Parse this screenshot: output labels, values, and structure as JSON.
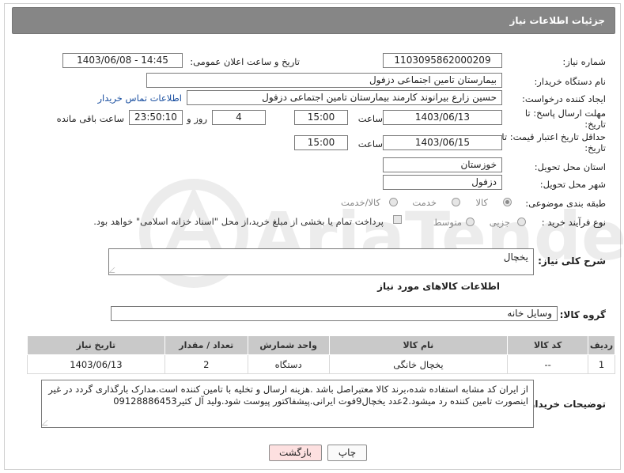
{
  "header": {
    "title": "جزئیات اطلاعات نیاز"
  },
  "form": {
    "need_number_label": "شماره نیاز:",
    "need_number": "1103095862000209",
    "announce_label": "تاریخ و ساعت اعلان عمومی:",
    "announce_value": "1403/06/08 - 14:45",
    "buyer_org_label": "نام دستگاه خریدار:",
    "buyer_org": "بیمارستان تامین اجتماعی دزفول",
    "creator_label": "ایجاد کننده درخواست:",
    "creator": "حسین زارع بیرانوند کارمند بیمارستان تامین اجتماعی دزفول",
    "contact_link": "اطلاعات تماس خریدار",
    "deadline_label_1": "مهلت ارسال پاسخ: تا",
    "deadline_label_2": "تاریخ:",
    "deadline_date": "1403/06/13",
    "time_label": "ساعت",
    "deadline_time": "15:00",
    "days_value": "4",
    "days_label": "روز و",
    "remaining_time": "23:50:10",
    "remaining_label": "ساعت باقی مانده",
    "validity_label_1": "حداقل تاریخ اعتبار قیمت: تا",
    "validity_label_2": "تاریخ:",
    "validity_date": "1403/06/15",
    "validity_time": "15:00",
    "province_label": "استان محل تحویل:",
    "province": "خوزستان",
    "city_label": "شهر محل تحویل:",
    "city": "دزفول",
    "category_label": "طبقه بندی موضوعی:",
    "category_options": [
      "کالا",
      "خدمت",
      "کالا/خدمت"
    ],
    "category_selected": "کالا",
    "process_label": "نوع فرآیند خرید :",
    "process_options": [
      "جزیی",
      "متوسط"
    ],
    "payment_note": "پرداخت تمام یا بخشی از مبلغ خرید،از محل \"اسناد خزانه اسلامی\" خواهد بود."
  },
  "description": {
    "label": "شرح کلی نیاز:",
    "value": "یخچال"
  },
  "goods_section_title": "اطلاعات کالاهای مورد نیاز",
  "goods_group": {
    "label": "گروه کالا:",
    "value": "وسایل خانه"
  },
  "table": {
    "headers": [
      "ردیف",
      "کد کالا",
      "نام کالا",
      "واحد شمارش",
      "تعداد / مقدار",
      "تاریخ نیاز"
    ],
    "rows": [
      [
        "1",
        "--",
        "یخچال خانگی",
        "دستگاه",
        "2",
        "1403/06/13"
      ]
    ]
  },
  "buyer_notes": {
    "label": "توضیحات خریدار:",
    "value": "از ایران کد مشابه استفاده شده،برند کالا معتبراصل باشد .هزینه ارسال و تخلیه با تامین کننده است.مدارک بارگذاری گردد در غیر اینصورت تامین کننده رد میشود.2عدد یخچال9فوت ایرانی.پیشفاکتور پیوست شود.ولید آل کثیر09128886453"
  },
  "buttons": {
    "print": "چاپ",
    "back": "بازگشت"
  },
  "watermark": {
    "text": "AriaTender.net"
  },
  "colors": {
    "header_bg": "#868686",
    "table_header_bg": "#c9c9c9",
    "link": "#1a4fa0",
    "back_button_bg": "#fde0e0"
  }
}
